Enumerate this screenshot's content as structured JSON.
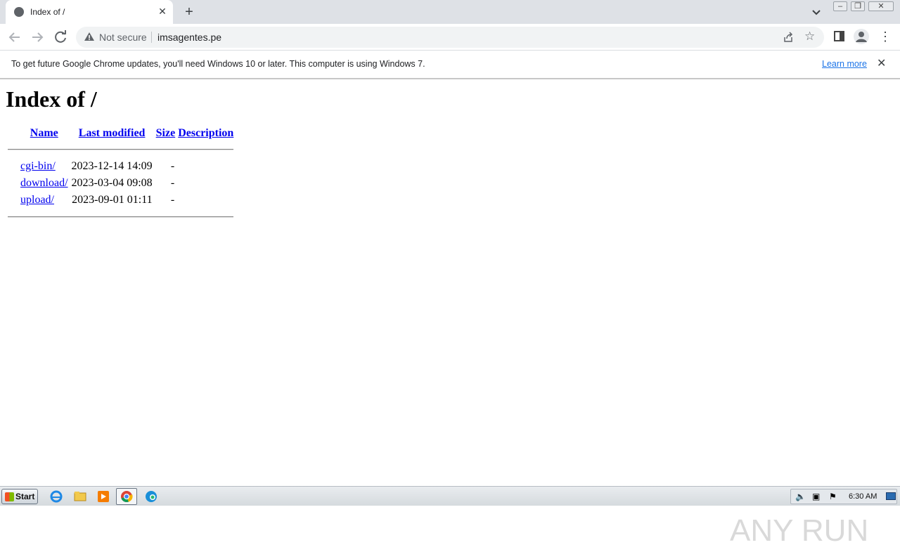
{
  "browser": {
    "tab_title": "Index of /",
    "tab_close": "✕",
    "new_tab": "+",
    "security_label": "Not secure",
    "url": "imsagentes.pe"
  },
  "infobar": {
    "message": "To get future Google Chrome updates, you'll need Windows 10 or later. This computer is using Windows 7.",
    "learn_more": "Learn more",
    "close": "✕"
  },
  "page": {
    "heading": "Index of /",
    "columns": [
      "Name",
      "Last modified",
      "Size",
      "Description"
    ],
    "rows": [
      {
        "name": "cgi-bin/",
        "modified": "2023-12-14 14:09",
        "size": "-",
        "description": ""
      },
      {
        "name": "download/",
        "modified": "2023-03-04 09:08",
        "size": "-",
        "description": ""
      },
      {
        "name": "upload/",
        "modified": "2023-09-01 01:11",
        "size": "-",
        "description": ""
      }
    ]
  },
  "taskbar": {
    "start_label": "Start",
    "clock": "6:30 AM"
  },
  "watermark": {
    "text": "ANY RUN"
  },
  "icons": {
    "back": "back-arrow-icon",
    "forward": "forward-arrow-icon",
    "reload": "reload-icon",
    "warning": "warning-triangle-icon",
    "share": "share-icon",
    "star": "bookmark-star-icon",
    "menu": "kebab-menu-icon"
  }
}
